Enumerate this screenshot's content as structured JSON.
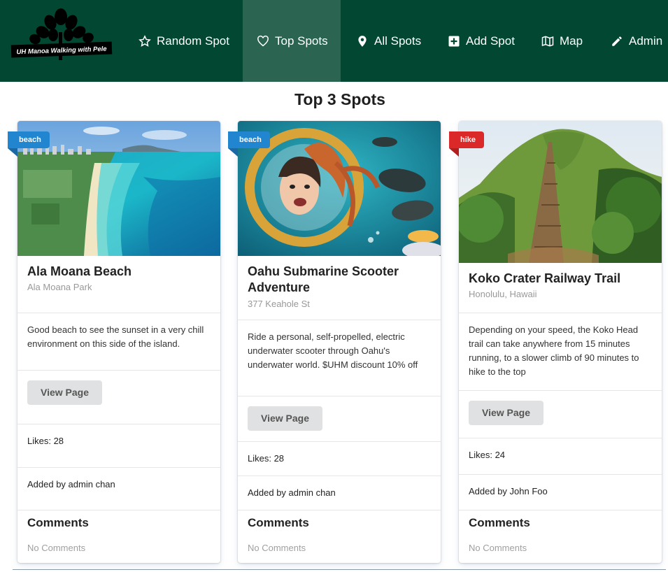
{
  "navbar": {
    "logo_text": "UH Manoa Walking with Pele",
    "items": [
      {
        "label": "Random Spot",
        "icon": "star-icon"
      },
      {
        "label": "Top Spots",
        "icon": "heart-icon",
        "active": true
      },
      {
        "label": "All Spots",
        "icon": "map-marker-icon"
      },
      {
        "label": "Add Spot",
        "icon": "plus-square-icon"
      },
      {
        "label": "Map",
        "icon": "map-icon"
      },
      {
        "label": "Admin",
        "icon": "pencil-icon"
      }
    ],
    "colors": {
      "background": "#024731",
      "active": "#2b6552"
    }
  },
  "page_title": "Top 3 Spots",
  "cards": [
    {
      "tag": "beach",
      "tag_color": "#2185d0",
      "title": "Ala Moana Beach",
      "location": "Ala Moana Park",
      "description": "Good beach to see the sunset in a very chill environment on this side of the island.",
      "button": "View Page",
      "likes": "Likes: 28",
      "added_by": "Added by admin chan",
      "comments_title": "Comments",
      "comments_empty": "No Comments"
    },
    {
      "tag": "beach",
      "tag_color": "#2185d0",
      "title": "Oahu Submarine Scooter Adventure",
      "location": "377 Keahole St",
      "description": "Ride a personal, self-propelled, electric underwater scooter through Oahu's underwater world. $UHM discount 10% off",
      "button": "View Page",
      "likes": "Likes: 28",
      "added_by": "Added by admin chan",
      "comments_title": "Comments",
      "comments_empty": "No Comments"
    },
    {
      "tag": "hike",
      "tag_color": "#db2828",
      "title": "Koko Crater Railway Trail",
      "location": "Honolulu, Hawaii",
      "description": "Depending on your speed, the Koko Head trail can take anywhere from 15 minutes running, to a slower climb of 90 minutes to hike to the top",
      "button": "View Page",
      "likes": "Likes: 24",
      "added_by": "Added by John Foo",
      "comments_title": "Comments",
      "comments_empty": "No Comments"
    }
  ]
}
